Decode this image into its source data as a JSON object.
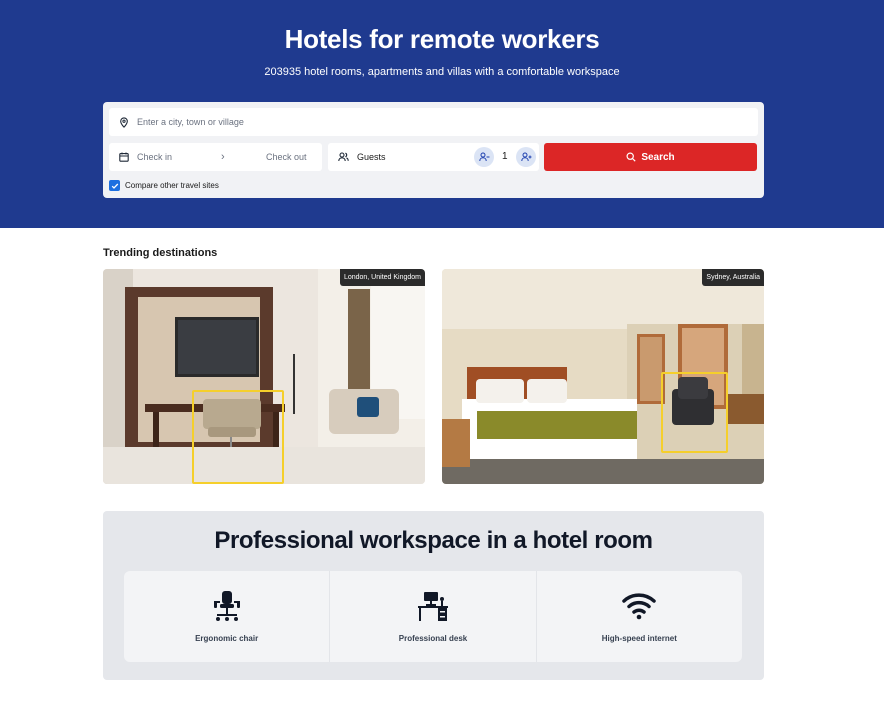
{
  "hero": {
    "title": "Hotels for remote workers",
    "subtitle": "203935 hotel rooms, apartments and villas with a comfortable workspace",
    "background_color": "#1f3a8f"
  },
  "search": {
    "destination_placeholder": "Enter a city, town or village",
    "check_in_placeholder": "Check in",
    "check_out_placeholder": "Check out",
    "guests_label": "Guests",
    "guests_count": "1",
    "search_button_label": "Search",
    "compare_label": "Compare other travel sites",
    "compare_checked": true,
    "accent_color": "#dc2626",
    "icons": [
      "pin-icon",
      "calendar-icon",
      "chevron-right-icon",
      "users-icon",
      "remove-user-icon",
      "add-user-icon",
      "search-icon",
      "checkmark-icon"
    ]
  },
  "trending": {
    "title": "Trending destinations",
    "destinations": [
      {
        "location": "London, United Kingdom",
        "photo": "hotel room with desk, ergonomic chair and armchair"
      },
      {
        "location": "Sydney, Australia",
        "photo": "hotel bedroom with bed, desk and office chair"
      }
    ],
    "highlight_color": "#f5cf2b"
  },
  "workspace": {
    "title": "Professional workspace in a hotel room",
    "features": [
      {
        "label": "Ergonomic chair",
        "icon": "office-chair-icon"
      },
      {
        "label": "Professional desk",
        "icon": "desk-icon"
      },
      {
        "label": "High-speed internet",
        "icon": "wifi-icon"
      }
    ]
  }
}
